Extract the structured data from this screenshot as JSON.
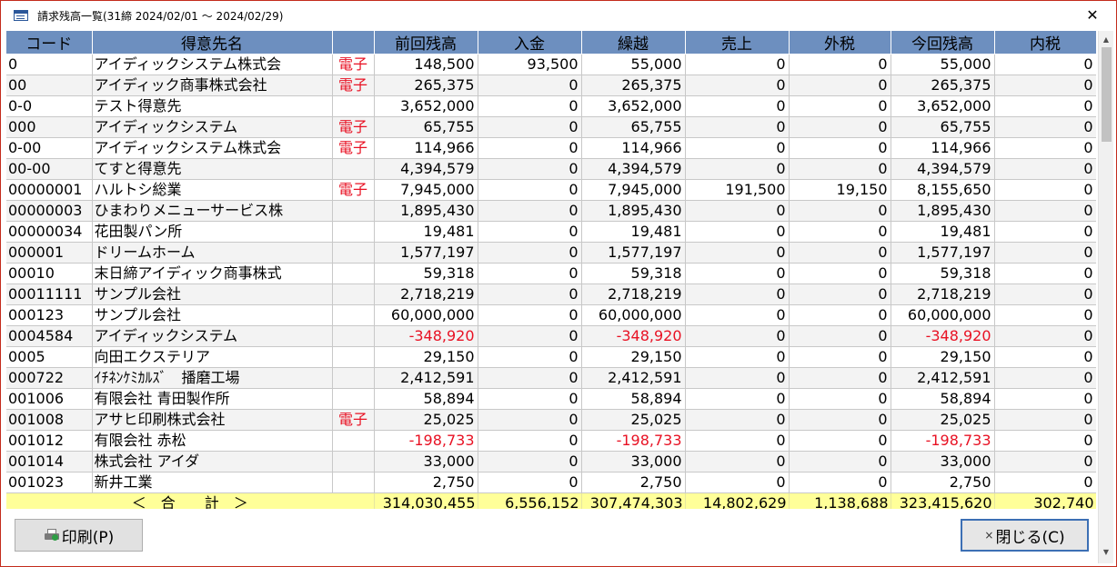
{
  "window": {
    "title": "請求残高一覧(31締 2024/02/01 ～ 2024/02/29)",
    "close_glyph": "✕"
  },
  "columns": [
    "コード",
    "得意先名",
    "",
    "前回残高",
    "入金",
    "繰越",
    "売上",
    "外税",
    "今回残高",
    "内税"
  ],
  "rows": [
    {
      "code": "0",
      "name": "アイディックシステム株式会",
      "tag": "電子",
      "prev": "148,500",
      "paid": "93,500",
      "carry": "55,000",
      "sales": "0",
      "tax_ext": "0",
      "curr": "55,000",
      "tax_int": "0",
      "neg": false
    },
    {
      "code": "00",
      "name": "アイディック商事株式会社",
      "tag": "電子",
      "prev": "265,375",
      "paid": "0",
      "carry": "265,375",
      "sales": "0",
      "tax_ext": "0",
      "curr": "265,375",
      "tax_int": "0",
      "neg": false
    },
    {
      "code": "0-0",
      "name": "テスト得意先",
      "tag": "",
      "prev": "3,652,000",
      "paid": "0",
      "carry": "3,652,000",
      "sales": "0",
      "tax_ext": "0",
      "curr": "3,652,000",
      "tax_int": "0",
      "neg": false
    },
    {
      "code": "000",
      "name": "アイディックシステム",
      "tag": "電子",
      "prev": "65,755",
      "paid": "0",
      "carry": "65,755",
      "sales": "0",
      "tax_ext": "0",
      "curr": "65,755",
      "tax_int": "0",
      "neg": false
    },
    {
      "code": "0-00",
      "name": "アイディックシステム株式会",
      "tag": "電子",
      "prev": "114,966",
      "paid": "0",
      "carry": "114,966",
      "sales": "0",
      "tax_ext": "0",
      "curr": "114,966",
      "tax_int": "0",
      "neg": false
    },
    {
      "code": "00-00",
      "name": "てすと得意先",
      "tag": "",
      "prev": "4,394,579",
      "paid": "0",
      "carry": "4,394,579",
      "sales": "0",
      "tax_ext": "0",
      "curr": "4,394,579",
      "tax_int": "0",
      "neg": false
    },
    {
      "code": "00000001",
      "name": "ハルトシ総業",
      "tag": "電子",
      "prev": "7,945,000",
      "paid": "0",
      "carry": "7,945,000",
      "sales": "191,500",
      "tax_ext": "19,150",
      "curr": "8,155,650",
      "tax_int": "0",
      "neg": false
    },
    {
      "code": "00000003",
      "name": "ひまわりメニューサービス株",
      "tag": "",
      "prev": "1,895,430",
      "paid": "0",
      "carry": "1,895,430",
      "sales": "0",
      "tax_ext": "0",
      "curr": "1,895,430",
      "tax_int": "0",
      "neg": false
    },
    {
      "code": "00000034",
      "name": "花田製パン所",
      "tag": "",
      "prev": "19,481",
      "paid": "0",
      "carry": "19,481",
      "sales": "0",
      "tax_ext": "0",
      "curr": "19,481",
      "tax_int": "0",
      "neg": false
    },
    {
      "code": "000001",
      "name": "ドリームホーム",
      "tag": "",
      "prev": "1,577,197",
      "paid": "0",
      "carry": "1,577,197",
      "sales": "0",
      "tax_ext": "0",
      "curr": "1,577,197",
      "tax_int": "0",
      "neg": false
    },
    {
      "code": "00010",
      "name": "末日締アイディック商事株式",
      "tag": "",
      "prev": "59,318",
      "paid": "0",
      "carry": "59,318",
      "sales": "0",
      "tax_ext": "0",
      "curr": "59,318",
      "tax_int": "0",
      "neg": false
    },
    {
      "code": "00011111",
      "name": "サンプル会社",
      "tag": "",
      "prev": "2,718,219",
      "paid": "0",
      "carry": "2,718,219",
      "sales": "0",
      "tax_ext": "0",
      "curr": "2,718,219",
      "tax_int": "0",
      "neg": false
    },
    {
      "code": "000123",
      "name": "サンプル会社",
      "tag": "",
      "prev": "60,000,000",
      "paid": "0",
      "carry": "60,000,000",
      "sales": "0",
      "tax_ext": "0",
      "curr": "60,000,000",
      "tax_int": "0",
      "neg": false
    },
    {
      "code": "0004584",
      "name": "アイディックシステム",
      "tag": "",
      "prev": "-348,920",
      "paid": "0",
      "carry": "-348,920",
      "sales": "0",
      "tax_ext": "0",
      "curr": "-348,920",
      "tax_int": "0",
      "neg": true
    },
    {
      "code": "0005",
      "name": "向田エクステリア",
      "tag": "",
      "prev": "29,150",
      "paid": "0",
      "carry": "29,150",
      "sales": "0",
      "tax_ext": "0",
      "curr": "29,150",
      "tax_int": "0",
      "neg": false
    },
    {
      "code": "000722",
      "name": "ｲﾁﾈﾝｹﾐｶﾙｽﾞ　播磨工場",
      "tag": "",
      "prev": "2,412,591",
      "paid": "0",
      "carry": "2,412,591",
      "sales": "0",
      "tax_ext": "0",
      "curr": "2,412,591",
      "tax_int": "0",
      "neg": false
    },
    {
      "code": "001006",
      "name": "有限会社 青田製作所",
      "tag": "",
      "prev": "58,894",
      "paid": "0",
      "carry": "58,894",
      "sales": "0",
      "tax_ext": "0",
      "curr": "58,894",
      "tax_int": "0",
      "neg": false
    },
    {
      "code": "001008",
      "name": "アサヒ印刷株式会社",
      "tag": "電子",
      "prev": "25,025",
      "paid": "0",
      "carry": "25,025",
      "sales": "0",
      "tax_ext": "0",
      "curr": "25,025",
      "tax_int": "0",
      "neg": false
    },
    {
      "code": "001012",
      "name": "有限会社 赤松",
      "tag": "",
      "prev": "-198,733",
      "paid": "0",
      "carry": "-198,733",
      "sales": "0",
      "tax_ext": "0",
      "curr": "-198,733",
      "tax_int": "0",
      "neg": true
    },
    {
      "code": "001014",
      "name": "株式会社 アイダ",
      "tag": "",
      "prev": "33,000",
      "paid": "0",
      "carry": "33,000",
      "sales": "0",
      "tax_ext": "0",
      "curr": "33,000",
      "tax_int": "0",
      "neg": false
    },
    {
      "code": "001023",
      "name": "新井工業",
      "tag": "",
      "prev": "2,750",
      "paid": "0",
      "carry": "2,750",
      "sales": "0",
      "tax_ext": "0",
      "curr": "2,750",
      "tax_int": "0",
      "neg": false
    }
  ],
  "totals": {
    "label": "＜　合　　計　＞",
    "prev": "314,030,455",
    "paid": "6,556,152",
    "carry": "307,474,303",
    "sales": "14,802,629",
    "tax_ext": "1,138,688",
    "curr": "323,415,620",
    "tax_int": "302,740"
  },
  "buttons": {
    "print_label": "印刷(P)",
    "close_label": "閉じる(C)",
    "close_glyph": "×"
  },
  "scrollbar": {
    "up_glyph": "▲",
    "down_glyph": "▼"
  },
  "colors": {
    "header_bg": "#6d8fbf",
    "total_bg": "#ffff99",
    "negative": "#e81123",
    "tag": "#e81123",
    "window_border": "#c42b1c"
  }
}
